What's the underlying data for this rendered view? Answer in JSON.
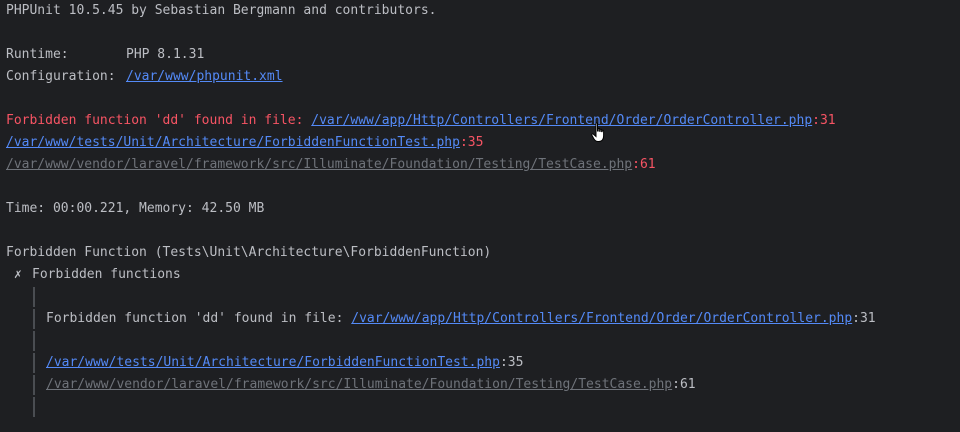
{
  "header": {
    "version_line": "PHPUnit 10.5.45 by Sebastian Bergmann and contributors."
  },
  "runtime": {
    "label": "Runtime:",
    "value": "PHP 8.1.31"
  },
  "configuration": {
    "label": "Configuration:",
    "path": "/var/www/phpunit.xml"
  },
  "error_top": {
    "message": "Forbidden function 'dd' found in file: ",
    "file": "/var/www/app/Http/Controllers/Frontend/Order/OrderController.php",
    "line": ":31"
  },
  "trace_top": [
    {
      "file": "/var/www/tests/Unit/Architecture/ForbiddenFunctionTest.php",
      "line": ":35"
    },
    {
      "file": "/var/www/vendor/laravel/framework/src/Illuminate/Foundation/Testing/TestCase.php",
      "line": ":61"
    }
  ],
  "summary": {
    "time_memory": "Time: 00:00.221, Memory: 42.50 MB"
  },
  "suite": {
    "title": "Forbidden Function (Tests\\Unit\\Architecture\\ForbiddenFunction)",
    "test": {
      "mark": "✗",
      "name": "Forbidden functions"
    }
  },
  "detail": {
    "message": "Forbidden function 'dd' found in file: ",
    "file": "/var/www/app/Http/Controllers/Frontend/Order/OrderController.php",
    "line": ":31",
    "trace": [
      {
        "file": "/var/www/tests/Unit/Architecture/ForbiddenFunctionTest.php",
        "line": ":35"
      },
      {
        "file": "/var/www/vendor/laravel/framework/src/Illuminate/Foundation/Testing/TestCase.php",
        "line": ":61"
      }
    ]
  },
  "colors": {
    "background": "#1e1f22",
    "text": "#bcbec4",
    "link": "#548af7",
    "error": "#f75464",
    "muted": "#6f737a"
  },
  "icons": {
    "mouse_cursor": "hand-pointer-icon"
  }
}
